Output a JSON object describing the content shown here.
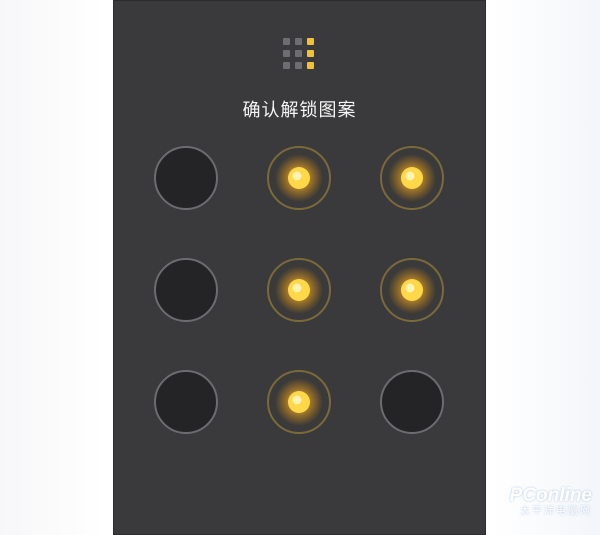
{
  "screen": {
    "title": "确认解锁图案"
  },
  "pattern": {
    "grid_size": 3,
    "selected_nodes": [
      7,
      1,
      4,
      5,
      2
    ],
    "indicator_lit": [
      2,
      5,
      8
    ],
    "accent_color": "#ffcf2e"
  },
  "watermark": {
    "brand": "PConline",
    "subtitle": "太平洋电脑网"
  },
  "icons": {
    "indicator": "pattern-grid-icon"
  }
}
